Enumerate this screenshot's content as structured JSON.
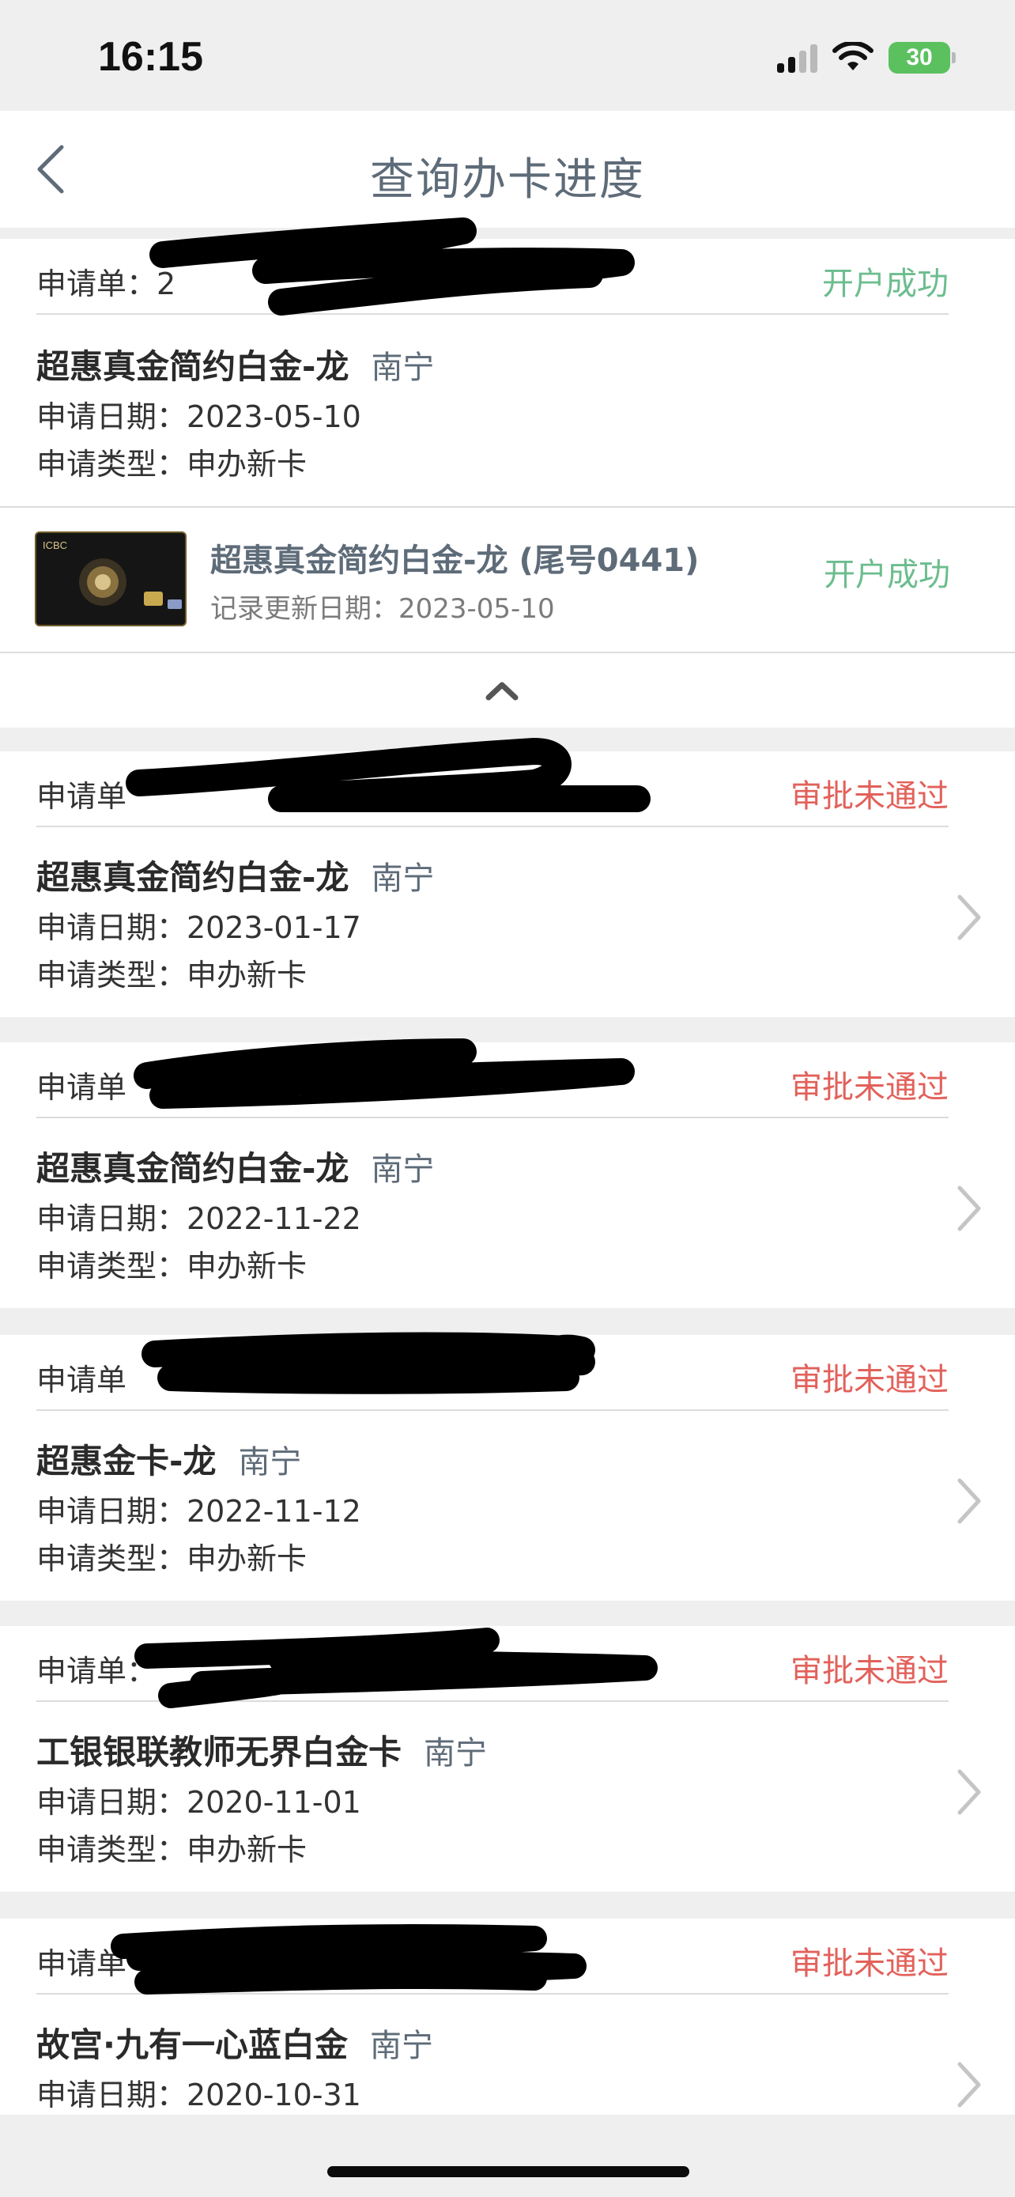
{
  "status_bar": {
    "time": "16:15",
    "battery": "30"
  },
  "nav": {
    "title": "查询办卡进度"
  },
  "app_no_label": "申请单",
  "app_no_label_colon": "申请单：",
  "applications": [
    {
      "status": "开户成功",
      "card_name": "超惠真金简约白金-龙",
      "city": "南宁",
      "date_line": "申请日期：2023-05-10",
      "type_line": "申请类型：申办新卡",
      "no_prefix": "申请单：2"
    },
    {
      "status": "审批未通过",
      "card_name": "超惠真金简约白金-龙",
      "city": "南宁",
      "date_line": "申请日期：2023-01-17",
      "type_line": "申请类型：申办新卡"
    },
    {
      "status": "审批未通过",
      "card_name": "超惠真金简约白金-龙",
      "city": "南宁",
      "date_line": "申请日期：2022-11-22",
      "type_line": "申请类型：申办新卡"
    },
    {
      "status": "审批未通过",
      "card_name": "超惠金卡-龙",
      "city": "南宁",
      "date_line": "申请日期：2022-11-12",
      "type_line": "申请类型：申办新卡"
    },
    {
      "status": "审批未通过",
      "card_name": "工银银联教师无界白金卡",
      "city": "南宁",
      "date_line": "申请日期：2020-11-01",
      "type_line": "申请类型：申办新卡"
    },
    {
      "status": "审批未通过",
      "card_name": "故宫·九有一心蓝白金",
      "city": "南宁",
      "date_line": "申请日期：2020-10-31"
    }
  ],
  "card_record": {
    "title": "超惠真金简约白金-龙 (尾号0441)",
    "update_line": "记录更新日期：2023-05-10",
    "status": "开户成功",
    "thumb_brand": "ICBC"
  },
  "colors": {
    "success": "#6cbd8e",
    "fail": "#e2615b",
    "nav_title": "#5e6b78",
    "page_bg": "#efefef"
  }
}
